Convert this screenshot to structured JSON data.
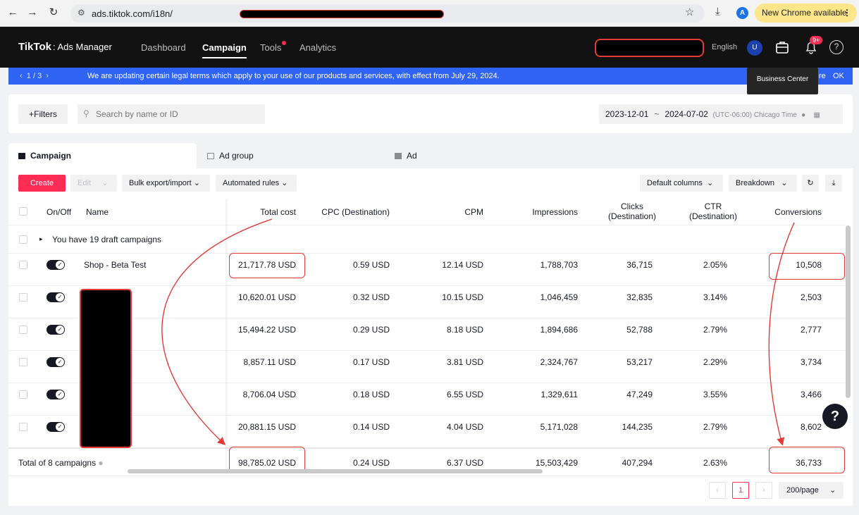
{
  "browser": {
    "url": "ads.tiktok.com/i18n/",
    "update_label": "New Chrome available",
    "more": "⋮",
    "profile": "A"
  },
  "header": {
    "logo_main": "TikTok",
    "logo_sub": ": Ads Manager",
    "nav": [
      "Dashboard",
      "Campaign",
      "Tools",
      "Analytics"
    ],
    "active_nav": "Campaign",
    "language": "English",
    "user_initial": "U",
    "notif_badge": "9+",
    "help": "?"
  },
  "tooltip": "Business Center",
  "announcement": {
    "pager": "1 / 3",
    "message": "We are updating certain legal terms which apply to your use of our products and services, with effect from July 29, 2024.",
    "more": "re",
    "ok": "OK"
  },
  "filters": {
    "filters_label": "+Filters",
    "search_placeholder": "Search by name or ID",
    "date_start": "2023-12-01",
    "date_sep": "~",
    "date_end": "2024-07-02",
    "timezone": "(UTC-06:00) Chicago Time"
  },
  "tabs": [
    "Campaign",
    "Ad group",
    "Ad"
  ],
  "toolbar": {
    "create": "Create",
    "edit": "Edit",
    "bulk": "Bulk export/import",
    "rules": "Automated rules",
    "columns": "Default columns",
    "breakdown": "Breakdown"
  },
  "table": {
    "headers": {
      "onoff": "On/Off",
      "name": "Name",
      "cost": "Total cost",
      "cpc": "CPC (Destination)",
      "cpm": "CPM",
      "impressions": "Impressions",
      "clicks_1": "Clicks",
      "clicks_2": "(Destination)",
      "ctr_1": "CTR",
      "ctr_2": "(Destination)",
      "conversions": "Conversions"
    },
    "draft_label": "You have 19 draft campaigns",
    "rows": [
      {
        "name": "Shop - Beta Test",
        "cost": "21,717.78 USD",
        "cpc": "0.59 USD",
        "cpm": "12.14 USD",
        "impressions": "1,788,703",
        "clicks": "36,715",
        "ctr": "2.05%",
        "conversions": "10,508"
      },
      {
        "name": "",
        "cost": "10,620.01 USD",
        "cpc": "0.32 USD",
        "cpm": "10.15 USD",
        "impressions": "1,046,459",
        "clicks": "32,835",
        "ctr": "3.14%",
        "conversions": "2,503"
      },
      {
        "name": "",
        "cost": "15,494.22 USD",
        "cpc": "0.29 USD",
        "cpm": "8.18 USD",
        "impressions": "1,894,686",
        "clicks": "52,788",
        "ctr": "2.79%",
        "conversions": "2,777"
      },
      {
        "name": "",
        "cost": "8,857.11 USD",
        "cpc": "0.17 USD",
        "cpm": "3.81 USD",
        "impressions": "2,324,767",
        "clicks": "53,217",
        "ctr": "2.29%",
        "conversions": "3,734"
      },
      {
        "name": "",
        "cost": "8,706.04 USD",
        "cpc": "0.18 USD",
        "cpm": "6.55 USD",
        "impressions": "1,329,611",
        "clicks": "47,249",
        "ctr": "3.55%",
        "conversions": "3,466"
      },
      {
        "name": "",
        "cost": "20,881.15 USD",
        "cpc": "0.14 USD",
        "cpm": "4.04 USD",
        "impressions": "5,171,028",
        "clicks": "144,235",
        "ctr": "2.79%",
        "conversions": "8,602"
      }
    ],
    "total": {
      "label": "Total of 8 campaigns",
      "cost": "98,785.02 USD",
      "cpc": "0.24 USD",
      "cpm": "6.37 USD",
      "impressions": "15,503,429",
      "clicks": "407,294",
      "ctr": "2.63%",
      "conversions": "36,733"
    }
  },
  "pagination": {
    "current": "1",
    "page_size": "200/page"
  },
  "colors": {
    "accent": "#fe2c55",
    "annotation": "#e53935",
    "banner": "#2f64f2"
  }
}
